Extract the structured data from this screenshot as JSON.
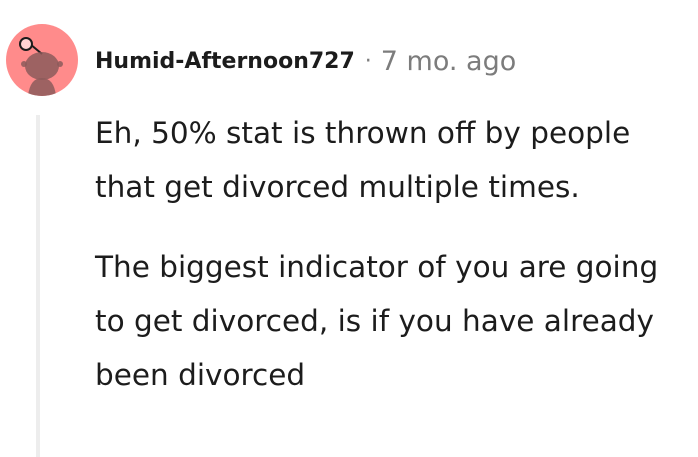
{
  "comment": {
    "author": "Humid-Afternoon727",
    "separator": "·",
    "timestamp": "7 mo. ago",
    "paragraphs": [
      "Eh, 50% stat is thrown off by people that get divorced multiple times.",
      "The biggest indicator of you are going to get divorced, is if you have already been divorced"
    ]
  },
  "colors": {
    "avatar_background": "#ff8b8b",
    "avatar_figure": "#8c5a5a",
    "meta_text": "#7c7c7c",
    "thread_line": "#ededed"
  },
  "icons": {
    "avatar": "reddit-snoo-avatar-icon"
  }
}
